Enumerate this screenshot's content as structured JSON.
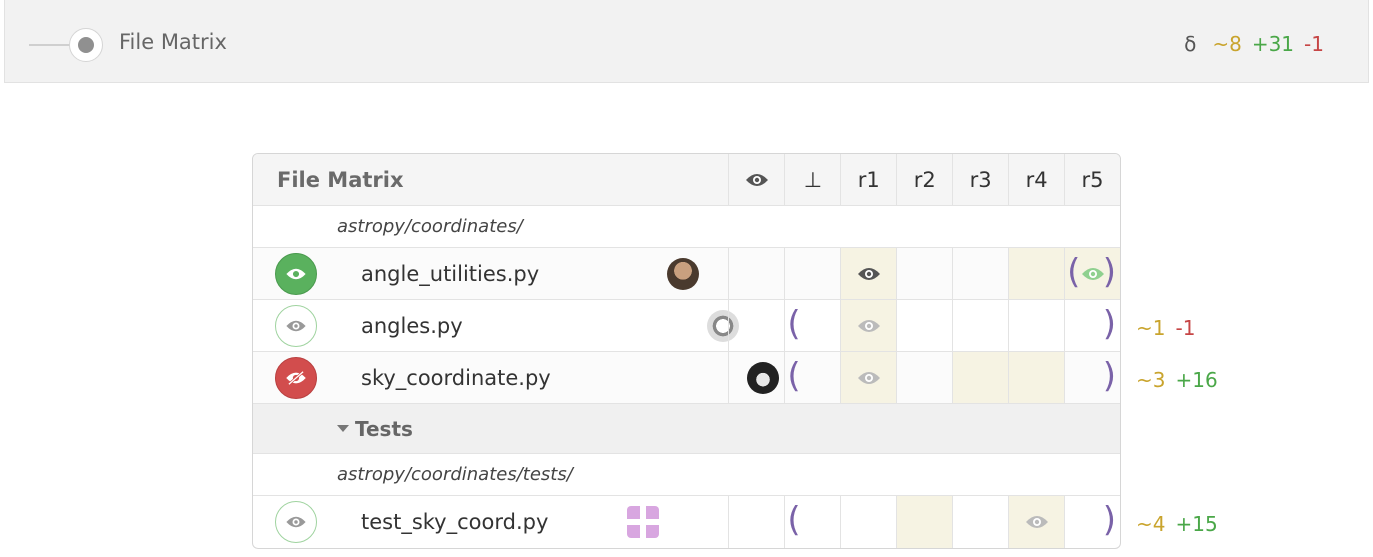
{
  "header": {
    "title": "File Matrix",
    "delta_symbol": "δ",
    "mod": "~8",
    "add": "+31",
    "del": "-1"
  },
  "matrix": {
    "title": "File Matrix",
    "columns": [
      "⊥",
      "r1",
      "r2",
      "r3",
      "r4",
      "r5"
    ],
    "dir1": "astropy/coordinates/",
    "files": [
      {
        "name": "angle_utilities.py"
      },
      {
        "name": "angles.py",
        "mod": "~1",
        "del": "-1"
      },
      {
        "name": "sky_coordinate.py",
        "mod": "~3",
        "add": "+16"
      }
    ],
    "group": "Tests",
    "dir2": "astropy/coordinates/tests/",
    "test_files": [
      {
        "name": "test_sky_coord.py",
        "mod": "~4",
        "add": "+15"
      }
    ]
  },
  "colors": {
    "mod": "#c9a42d",
    "add": "#4aa748",
    "del": "#c64545",
    "bracket": "#7a62a8",
    "tint": "#f6f3e3"
  },
  "icons": [
    "toggle-switch",
    "eye-icon",
    "eye-slash-icon",
    "caret-down-icon",
    "avatar"
  ]
}
